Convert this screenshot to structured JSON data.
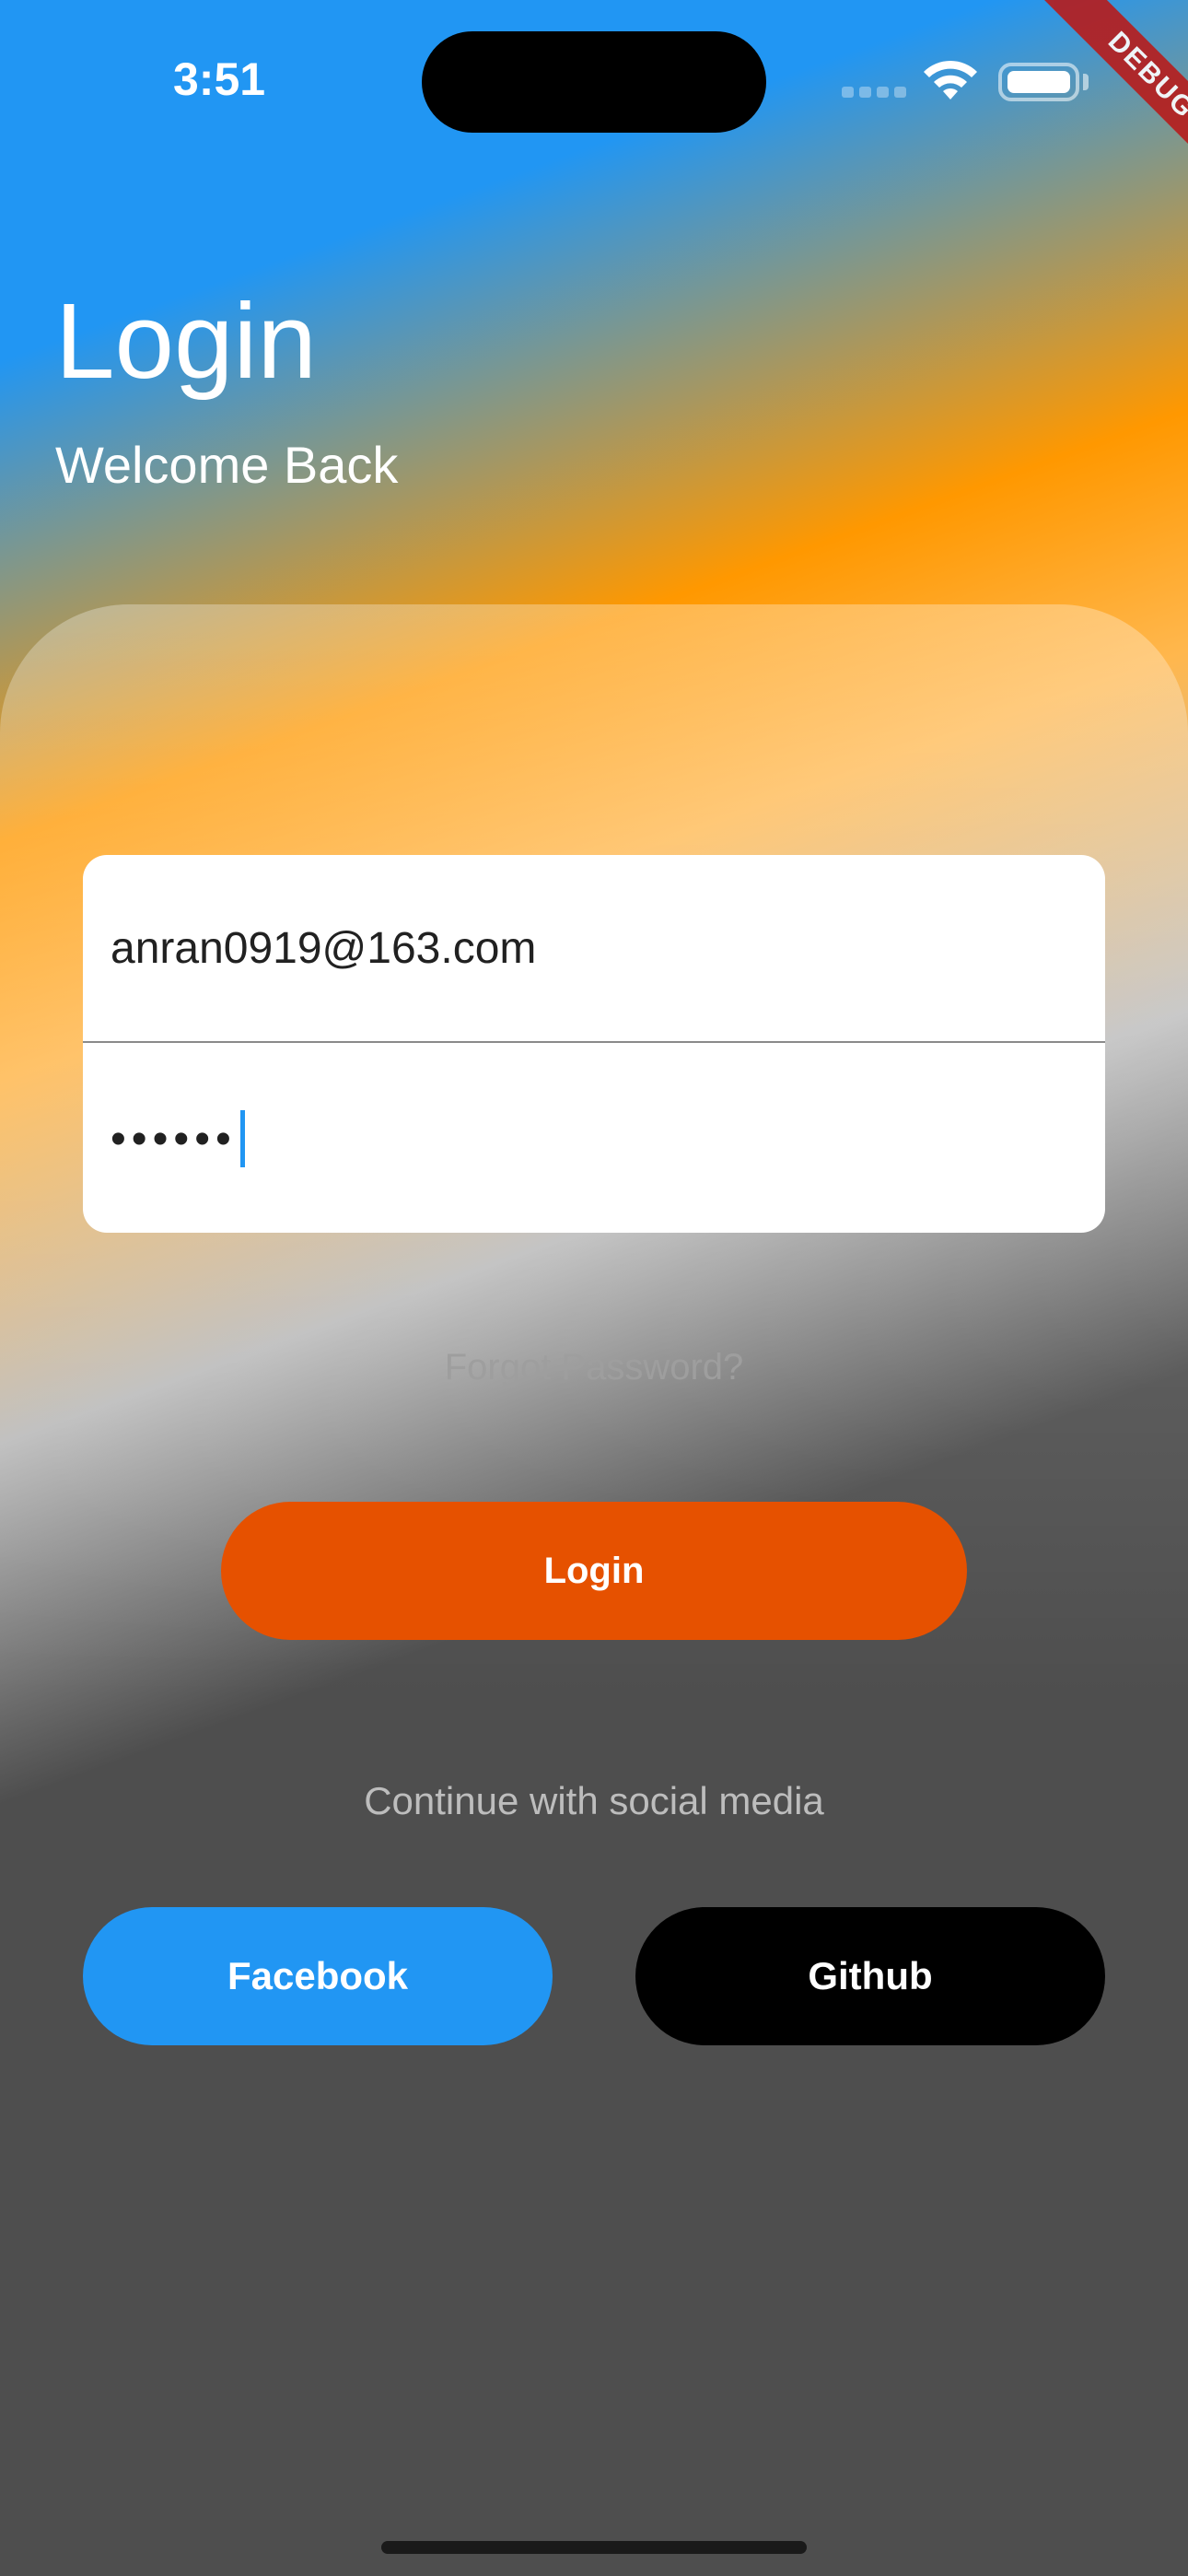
{
  "status_bar": {
    "time": "3:51",
    "icons": [
      "cellular-signal-icon",
      "wifi-icon",
      "battery-icon"
    ]
  },
  "debug_banner": "DEBUG",
  "header": {
    "title": "Login",
    "subtitle": "Welcome Back"
  },
  "form": {
    "email_value": "anran0919@163.com",
    "password_value": "••••••"
  },
  "forgot_password": "Forgot Password?",
  "login_button": "Login",
  "social": {
    "label": "Continue with social media",
    "facebook": "Facebook",
    "github": "Github"
  },
  "colors": {
    "blue": "#2196f3",
    "orange": "#ff9800",
    "login_button": "#e65100",
    "github_button": "#000000",
    "background_dark": "#4e4e4e"
  }
}
